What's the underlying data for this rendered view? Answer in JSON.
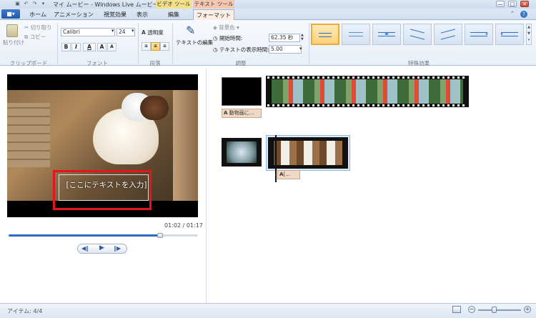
{
  "window": {
    "title": "マイ ムービー - Windows Live ムービー ...",
    "context_tab_video": "ビデオ ツール",
    "context_tab_text": "テキスト ツール"
  },
  "tabs": {
    "file": "■▾",
    "home": "ホーム",
    "animation": "アニメーション",
    "visual_effects": "視覚効果",
    "view": "表示",
    "edit": "編集",
    "format": "フォーマット"
  },
  "ribbon": {
    "clipboard": {
      "paste": "貼り付け",
      "cut": "切り取り",
      "copy": "コピー",
      "label": "クリップボード"
    },
    "font": {
      "family": "Calibri",
      "size": "24",
      "bold": "B",
      "italic": "I",
      "color": "A",
      "grow": "A",
      "shrink": "A",
      "label": "フォント"
    },
    "paragraph": {
      "transparency": "透明度",
      "label": "段落"
    },
    "adjust": {
      "edit_text": "テキストの編集",
      "bg_color": "背景色",
      "start_time_label": "開始時間:",
      "start_time_value": "62.35 秒",
      "duration_label": "テキストの表示時間:",
      "duration_value": "5.00",
      "label": "調整"
    },
    "effects": {
      "label": "特殊効果"
    }
  },
  "preview": {
    "caption_text": "[ここにテキストを入力]",
    "time": "01:02 / 01:17",
    "playhead_fraction": 0.8
  },
  "timeline": {
    "caption_1": "動物画に...",
    "caption_2": "[..."
  },
  "status": {
    "items": "アイテム: 4/4"
  },
  "colors": {
    "highlight_red": "#e8141b",
    "accent_blue": "#2b6cc4",
    "selected_orange": "#f0a83a"
  }
}
